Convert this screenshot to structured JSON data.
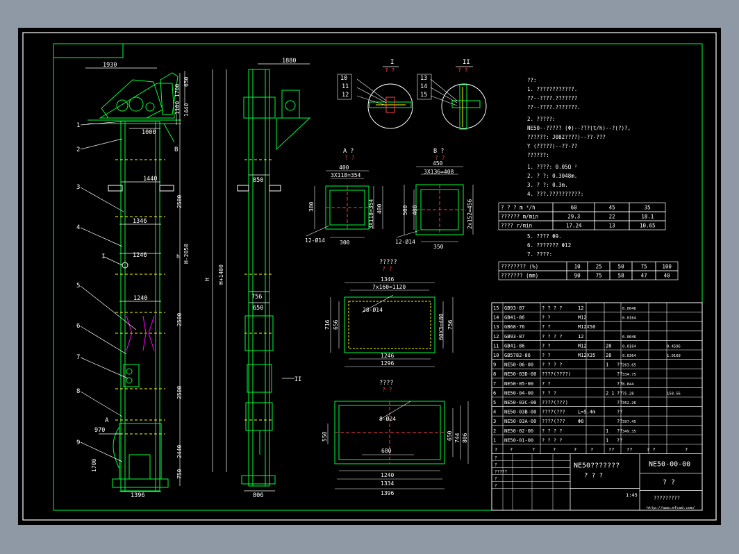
{
  "colors": {
    "frame": "#ffffff",
    "structure": "#00ff3a",
    "dimension": "#ffffff",
    "hidden": "#ffff00",
    "cut": "#ff4040",
    "text": "#ffffff",
    "accent": "#ff00ff"
  },
  "front_view": {
    "dims": [
      "1930",
      "1346",
      "1440",
      "1246",
      "1240",
      "1396",
      "650",
      "1700",
      "1440",
      "1000",
      "2500",
      "H-2050",
      "2500",
      "2500",
      "2440",
      "750",
      "H",
      "H+1400",
      "970",
      "1700",
      "h"
    ],
    "callouts": [
      "1",
      "2",
      "3",
      "4",
      "5",
      "6",
      "7",
      "8",
      "9"
    ],
    "section_marks": [
      "B",
      "I",
      "A"
    ]
  },
  "side_view": {
    "dims": [
      "1880",
      "850",
      "756",
      "650",
      "806"
    ],
    "callouts": [
      "II"
    ]
  },
  "detail_I": {
    "title": "I",
    "sub": "? ?",
    "callouts": [
      "10",
      "11",
      "12"
    ]
  },
  "detail_II": {
    "title": "II",
    "sub": "? ?",
    "callouts": [
      "13",
      "14",
      "15"
    ]
  },
  "section_A": {
    "title": "A ?",
    "dims": [
      "400",
      "3X118=354",
      "380",
      "400",
      "3X118=354",
      "300"
    ],
    "hole": "12-Ø14"
  },
  "section_B": {
    "title": "B ?",
    "dims": [
      "450",
      "3X136=408",
      "500",
      "400",
      "2x152=456",
      "350"
    ],
    "hole": "12-Ø14"
  },
  "view_flange": {
    "title": "?????",
    "sub": "? ?",
    "dims": [
      "1346",
      "7x160=1120",
      "716",
      "656",
      "60X3=480",
      "756",
      "1246",
      "1296"
    ],
    "hole": "28-Ø14"
  },
  "view_base": {
    "title": "????",
    "dims": [
      "550",
      "650",
      "744",
      "806",
      "680",
      "1240",
      "1334",
      "1396"
    ],
    "hole": "8-Ø24"
  },
  "notes": {
    "lines": [
      "??:",
      "1. ????????????.",
      "   ??--????.???????",
      "   ??--????.???????.",
      "2. ?????:",
      "   NE50--????? (Φ)--???(t/h)--?(?)?,",
      "   ??????: J082????)--??-???",
      "           Y (?????)--??-??",
      "   ??????:",
      "1. ????: 0.05Ω ²",
      "2. ?  ?: 0.3048m.",
      "3. ?  ?: 0.3m.",
      "4. ???.??????????:"
    ],
    "table1": {
      "rows": [
        [
          "? ? ?     m ³/h",
          "60",
          "45",
          "35"
        ],
        [
          "??????    m/min",
          "29.3",
          "22",
          "18.1"
        ],
        [
          "????     r/min",
          "17.24",
          "13",
          "10.65"
        ]
      ]
    },
    "lines2": [
      "5. ????  Φ9.",
      "6. ???????  Φ12",
      "7. ????:"
    ],
    "table2": {
      "rows": [
        [
          "???????? (%)",
          "10",
          "25",
          "50",
          "75",
          "100"
        ],
        [
          "??????? (mm)",
          "90",
          "75",
          "58",
          "47",
          "40"
        ]
      ]
    }
  },
  "bom": {
    "rows": [
      [
        "15",
        "GB93-87",
        "? ? ? ?",
        "12",
        "",
        "",
        "0.0046",
        ""
      ],
      [
        "14",
        "GB41-86",
        "? ?",
        "M12",
        "",
        "",
        "0.0164",
        ""
      ],
      [
        "13",
        "GB68-76",
        "? ?",
        "M12X50",
        "",
        "",
        "",
        ""
      ],
      [
        "12",
        "GB93-87",
        "? ? ? ?",
        "12",
        "",
        "",
        "0.0046",
        ""
      ],
      [
        "11",
        "GB41-86",
        "? ?",
        "M12",
        "28",
        "",
        "0.0164",
        "0.4596"
      ],
      [
        "10",
        "GB5782-86",
        "? ?",
        "M12X35",
        "28",
        "",
        "0.0364",
        "1.0169"
      ],
      [
        "9",
        "NE50-06-00",
        "? ? ? ?",
        "",
        "1",
        "??",
        "263.65",
        ""
      ],
      [
        "8",
        "NE50-03D-00",
        "????(????)",
        "",
        "",
        "??",
        "334.75",
        ""
      ],
      [
        "7",
        "NE50-05-00",
        "? ?",
        "",
        "",
        "??",
        "8.844",
        ""
      ],
      [
        "6",
        "NE50-04-00",
        "? ? ?",
        "",
        "2 1",
        "??",
        "75.28",
        "158.56"
      ],
      [
        "5",
        "NE50-03C-00",
        "????(???)",
        "",
        "",
        "??",
        "352.26",
        ""
      ],
      [
        "4",
        "NE50-03B-00",
        "????(???",
        "L=5.4m",
        "",
        "??",
        "",
        ""
      ],
      [
        "3",
        "NE50-03A-00",
        "????(???",
        "Φ8",
        "",
        "??",
        "397.45",
        ""
      ],
      [
        "2",
        "NE50-02-00",
        "? ? ? ?",
        "",
        "1",
        "??",
        "349.35",
        ""
      ],
      [
        "1",
        "NE50-01-00",
        "? ? ? ?",
        "",
        "1",
        "??",
        "",
        ""
      ]
    ],
    "header": [
      "?",
      "?",
      "?",
      "?",
      "?",
      "?",
      "??",
      "??",
      "? ?",
      "?"
    ]
  },
  "title_block": {
    "name": "NE50???????",
    "name_sub": "?  ?  ?",
    "drawing_no": "NE50-00-00",
    "unit": "? ?",
    "scale": "1:45",
    "url": "http://www.mfcad.com/",
    "company": "?????????",
    "small": [
      "?",
      "?",
      "?????",
      "?",
      "?",
      "?",
      "?",
      "?",
      "?",
      "?"
    ]
  }
}
